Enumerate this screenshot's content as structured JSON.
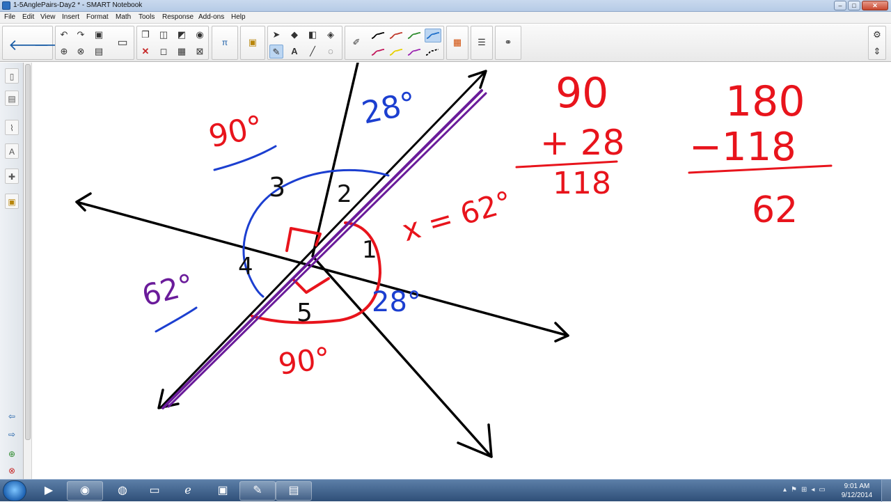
{
  "window": {
    "title": "1-5AnglePairs-Day2 * - SMART Notebook",
    "controls": [
      "–",
      "□",
      "✕"
    ]
  },
  "menu": [
    "File",
    "Edit",
    "View",
    "Insert",
    "Format",
    "Math",
    "Tools",
    "Response",
    "Add-ons",
    "Help"
  ],
  "toolbar": {
    "back_icon": "arrow-left-icon",
    "forward_icon": "arrow-right-icon",
    "pen_colors": [
      "#000000",
      "#c0392b",
      "#2e8b2e",
      "#1f6fc9",
      "#c2185b",
      "#e8d000",
      "#9c27b0",
      "#000000"
    ]
  },
  "board": {
    "angle_labels": [
      "3",
      "2",
      "1",
      "4",
      "5"
    ],
    "annotations": {
      "top_left_angle": "90°",
      "top_right_angle": "28°",
      "x_equation": "x = 62°",
      "left_angle": "62°",
      "right_angle": "28°",
      "bottom_angle": "90°"
    },
    "sum_problem": {
      "top": "90",
      "addend": "+ 28",
      "result": "118"
    },
    "diff_problem": {
      "top": "180",
      "subtrahend": "−118",
      "result": "62"
    }
  },
  "taskbar": {
    "clock_time": "9:01 AM",
    "clock_date": "9/12/2014"
  }
}
